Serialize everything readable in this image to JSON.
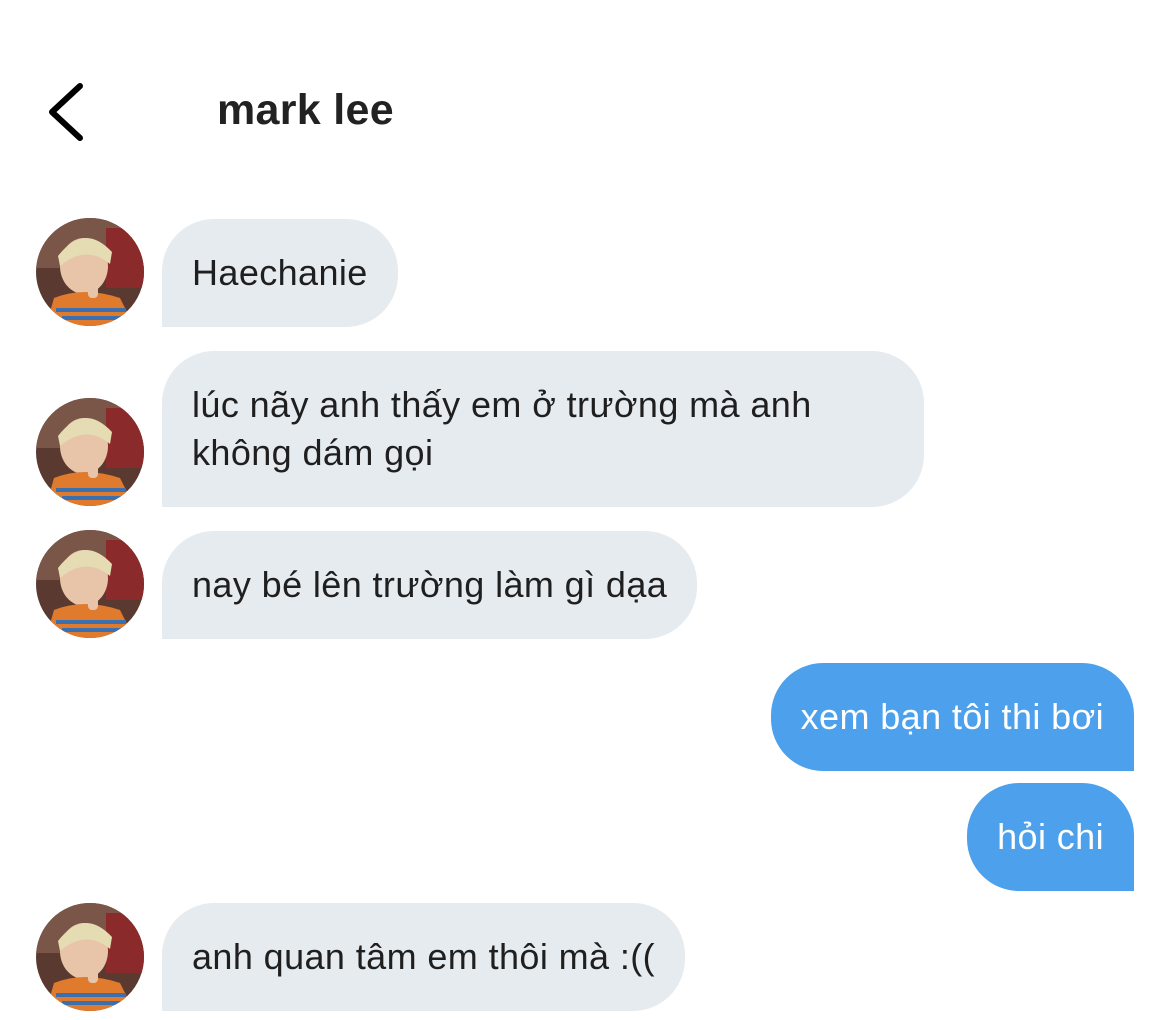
{
  "header": {
    "back_icon": "chevron-left-icon",
    "title": "mark lee"
  },
  "colors": {
    "incoming_bubble": "#e6ebf0",
    "outgoing_bubble": "#4da0eb",
    "title_text": "#222222"
  },
  "messages": [
    {
      "direction": "incoming",
      "text": "Haechanie",
      "avatar": "profile-photo"
    },
    {
      "direction": "incoming",
      "text": "lúc nãy anh thấy em ở trường mà anh\nkhông dám gọi",
      "avatar": "profile-photo"
    },
    {
      "direction": "incoming",
      "text": "nay bé lên trường làm gì dạa",
      "avatar": "profile-photo"
    },
    {
      "direction": "outgoing",
      "text": "xem bạn tôi thi bơi"
    },
    {
      "direction": "outgoing",
      "text": "hỏi chi"
    },
    {
      "direction": "incoming",
      "text": "anh quan tâm em thôi mà :((",
      "avatar": "profile-photo"
    }
  ]
}
